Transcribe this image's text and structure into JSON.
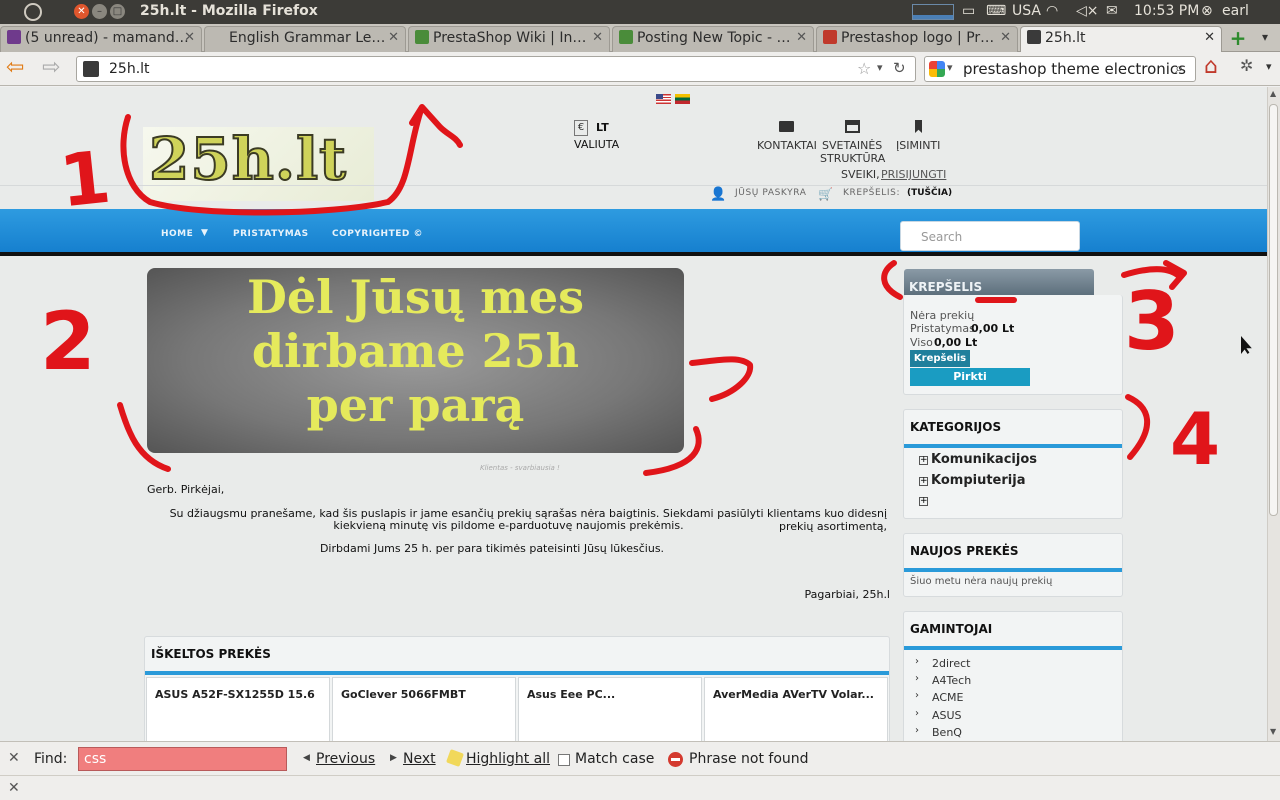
{
  "os": {
    "window_title": "25h.lt - Mozilla Firefox",
    "keyboard": "USA",
    "time": "10:53 PM",
    "user": "earl"
  },
  "browser": {
    "tabs": [
      {
        "label": "(5 unread) - mamand…",
        "fav": "#6f3a8c"
      },
      {
        "label": "English Grammar Le…",
        "fav": ""
      },
      {
        "label": "PrestaShop Wiki | In…",
        "fav": "#4a8c3a"
      },
      {
        "label": "Posting New Topic - …",
        "fav": "#4a8c3a"
      },
      {
        "label": "Prestashop logo | Pr…",
        "fav": "#c0392b"
      },
      {
        "label": "25h.lt",
        "fav": "#3a3a3a"
      }
    ],
    "url": "25h.lt",
    "web_search": "prestashop theme electronics"
  },
  "site": {
    "logo_text": "25h.lt",
    "currency_symbol": "€",
    "currency_code": "LT",
    "currency_label": "VALIUTA",
    "contacts": "KONTAKTAI",
    "sitemap_1": "SVETAINĖS",
    "sitemap_2": "STRUKTŪRA",
    "bookmark": "ĮSIMINTI",
    "greeting": "SVEIKI,",
    "login": "PRISIJUNGTI",
    "account": "JŪSŲ PASKYRA",
    "cart_label": "KREPŠELIS:",
    "cart_state": "(TUŠČIA)",
    "menu": [
      "HOME",
      "PRISTATYMAS",
      "COPYRIGHTED ©"
    ],
    "search_placeholder": "Search",
    "banner_lines": [
      "Dėl Jūsų mes",
      "dirbame 25h",
      "per parą"
    ],
    "banner_caption": "Klientas - svarbiausia !",
    "msg_greeting": "Gerb. Pirkėjai,",
    "msg_p1a": "Su džiaugsmu pranešame, kad šis puslapis ir jame esančių prekių sąrašas nėra baigtinis. Siekdami pasiūlyti klientams kuo didesnį prekių asortimentą,",
    "msg_p1b": "kiekvieną minutę vis pildome e-parduotuvę naujomis prekėmis.",
    "msg_p2": "Dirbdami Jums 25 h. per para tikimės pateisinti Jūsų lūkesčius.",
    "msg_sign": "Pagarbiai, 25h.l",
    "featured_title": "IŠKELTOS PREKĖS",
    "products": [
      "ASUS A52F-SX1255D 15.6",
      "GoClever 5066FMBT",
      "Asus Eee PC...",
      "AverMedia AVerTV Volar..."
    ],
    "cart_block": {
      "title": "KREPŠELIS",
      "empty": "Nėra prekių",
      "shipping_label": "Pristatymas",
      "shipping_value": "0,00 Lt",
      "total_label": "Viso",
      "total_value": "0,00 Lt",
      "cart_button": "Krepšelis",
      "buy_button": "Pirkti"
    },
    "categories_title": "KATEGORIJOS",
    "categories": [
      "Komunikacijos",
      "Kompiuterija",
      ""
    ],
    "new_title": "NAUJOS PREKĖS",
    "new_empty": "Šiuo metu nėra naujų prekių",
    "brands_title": "GAMINTOJAI",
    "brands": [
      "2direct",
      "A4Tech",
      "ACME",
      "ASUS",
      "BenQ"
    ]
  },
  "annotations": [
    "1",
    "2",
    "3",
    "4"
  ],
  "findbar": {
    "label": "Find:",
    "query": "css",
    "previous": "Previous",
    "next": "Next",
    "highlight": "Highlight all",
    "match_case": "Match case",
    "status": "Phrase not found"
  }
}
